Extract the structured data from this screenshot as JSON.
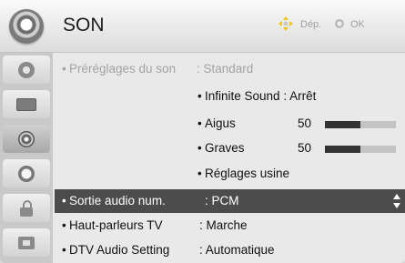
{
  "header": {
    "title": "SON",
    "hint_move": "Dép.",
    "hint_ok": "OK",
    "icon": "speaker-icon"
  },
  "sidebar": {
    "items": [
      {
        "icon": "picture-icon",
        "active": false
      },
      {
        "icon": "screen-icon",
        "active": false
      },
      {
        "icon": "speaker-icon",
        "active": true
      },
      {
        "icon": "clock-icon",
        "active": false
      },
      {
        "icon": "lock-icon",
        "active": false
      },
      {
        "icon": "options-icon",
        "active": false
      }
    ]
  },
  "menu": {
    "preset": {
      "label": "Préréglages du son",
      "value": ": Standard",
      "disabled": true
    },
    "infinite_sound": {
      "label": "Infinite Sound : Arrêt"
    },
    "treble": {
      "label": "Aigus",
      "value": "50",
      "level": 0.5
    },
    "bass": {
      "label": "Graves",
      "value": "50",
      "level": 0.5
    },
    "reset": {
      "label": "Réglages usine"
    },
    "digital_out": {
      "label": "Sortie audio num.",
      "value": ": PCM",
      "selected": true
    },
    "tv_speakers": {
      "label": "Haut-parleurs TV",
      "value": ": Marche"
    },
    "dtv_audio": {
      "label": "DTV Audio Setting",
      "value": ": Automatique"
    }
  },
  "colors": {
    "selection": "#4c4c4c",
    "background": "#e9e9e9",
    "bar_fill": "#333333",
    "bar_track": "#c4c4c4"
  }
}
